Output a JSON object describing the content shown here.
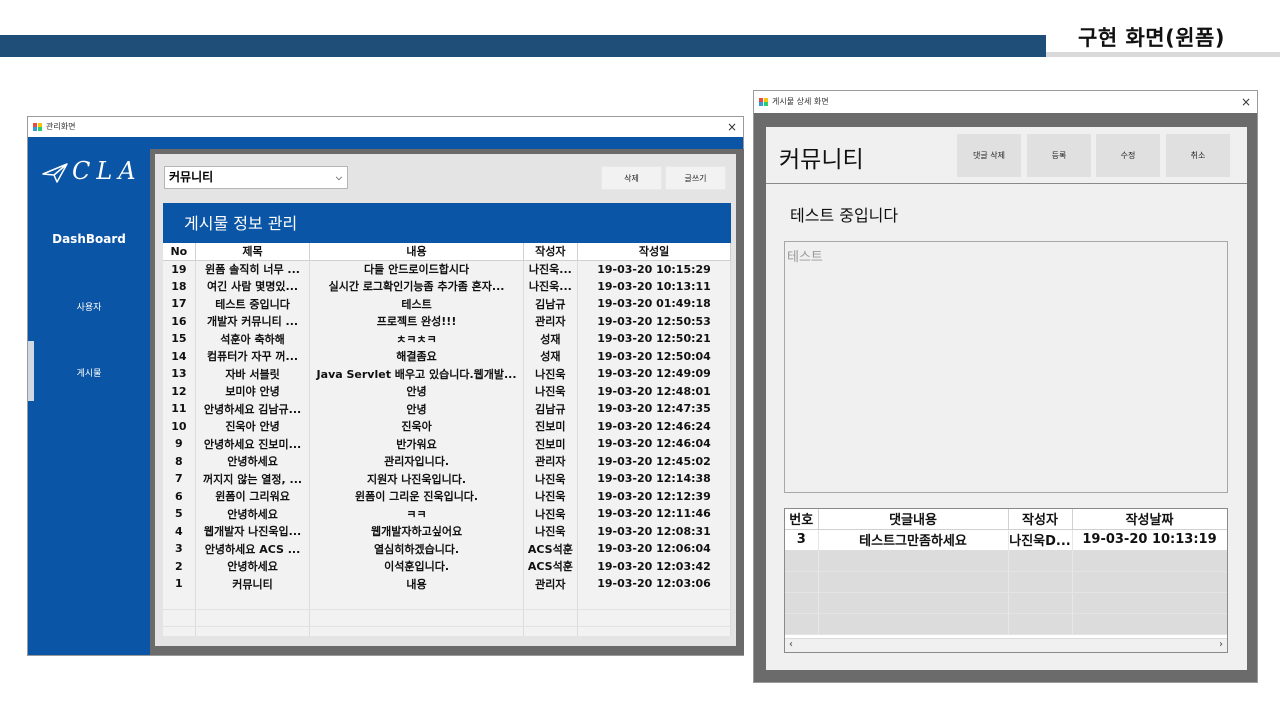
{
  "slide": {
    "title": "구현 화면(윈폼)"
  },
  "admin_window": {
    "title": "관리화면",
    "close": "×",
    "logo_text": "CLA",
    "nav": {
      "dashboard": "DashBoard",
      "users": "사용자",
      "posts": "게시물"
    },
    "board_select": "커뮤니티",
    "buttons": {
      "delete": "삭제",
      "write": "글쓰기"
    },
    "panel_title": "게시물 정보 관리",
    "columns": [
      "No",
      "제목",
      "내용",
      "작성자",
      "작성일"
    ],
    "rows": [
      [
        "19",
        "윈폼 솔직히 너무 ...",
        "다들 안드로이드합시다",
        "나진욱...",
        "19-03-20 10:15:29"
      ],
      [
        "18",
        "여긴 사람 몇명있...",
        "실시간 로그확인기능좀 추가좀 혼자...",
        "나진욱...",
        "19-03-20 10:13:11"
      ],
      [
        "17",
        "테스트 중입니다",
        "테스트",
        "김남규",
        "19-03-20 01:49:18"
      ],
      [
        "16",
        "개발자 커뮤니티 ...",
        "프로젝트 완성!!!",
        "관리자",
        "19-03-20 12:50:53"
      ],
      [
        "15",
        "석훈아 축하해",
        "ㅊㅋㅊㅋ",
        "성재",
        "19-03-20 12:50:21"
      ],
      [
        "14",
        "컴퓨터가 자꾸 꺼...",
        "해결좀요",
        "성재",
        "19-03-20 12:50:04"
      ],
      [
        "13",
        "자바 서블릿",
        "Java Servlet 배우고 있습니다.웹개발...",
        "나진욱",
        "19-03-20 12:49:09"
      ],
      [
        "12",
        "보미야 안녕",
        "안녕",
        "나진욱",
        "19-03-20 12:48:01"
      ],
      [
        "11",
        "안녕하세요 김남규...",
        "안녕",
        "김남규",
        "19-03-20 12:47:35"
      ],
      [
        "10",
        "진욱아 안녕",
        "진욱아",
        "진보미",
        "19-03-20 12:46:24"
      ],
      [
        "9",
        "안녕하세요 진보미...",
        "반가워요",
        "진보미",
        "19-03-20 12:46:04"
      ],
      [
        "8",
        "안녕하세요",
        "관리자입니다.",
        "관리자",
        "19-03-20 12:45:02"
      ],
      [
        "7",
        "꺼지지 않는 열정, ...",
        "지원자 나진욱입니다.",
        "나진욱",
        "19-03-20 12:14:38"
      ],
      [
        "6",
        "윈폼이 그리워요",
        "윈폼이 그리운 진욱입니다.",
        "나진욱",
        "19-03-20 12:12:39"
      ],
      [
        "5",
        "안녕하세요",
        "ㅋㅋ",
        "나진욱",
        "19-03-20 12:11:46"
      ],
      [
        "4",
        "웹개발자 나진욱입...",
        "웹개발자하고싶어요",
        "나진욱",
        "19-03-20 12:08:31"
      ],
      [
        "3",
        "안녕하세요 ACS ...",
        "열심히하겠습니다.",
        "ACS석훈",
        "19-03-20 12:06:04"
      ],
      [
        "2",
        "안녕하세요",
        "이석훈입니다.",
        "ACS석훈",
        "19-03-20 12:03:42"
      ],
      [
        "1",
        "커뮤니티",
        "내용",
        "관리자",
        "19-03-20 12:03:06"
      ]
    ]
  },
  "detail_window": {
    "title": "게시물 상세 화면",
    "close": "×",
    "header": "커뮤니티",
    "buttons": {
      "delete_comment": "댓글 삭제",
      "register": "등록",
      "edit": "수정",
      "cancel": "취소"
    },
    "post_title": "테스트 중입니다",
    "comment_input_placeholder": "테스트",
    "comment_columns": [
      "번호",
      "댓글내용",
      "작성자",
      "작성날짜"
    ],
    "comments": [
      [
        "3",
        "테스트그만좀하세요",
        "나진욱D...",
        "19-03-20 10:13:19"
      ]
    ],
    "scroll_left": "‹",
    "scroll_right": "›"
  }
}
